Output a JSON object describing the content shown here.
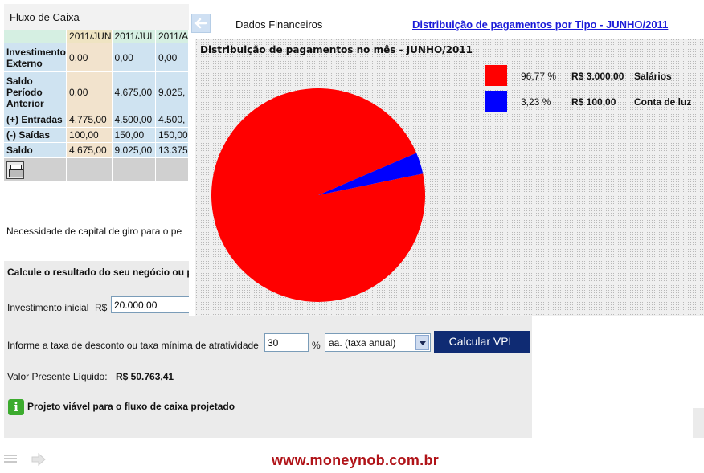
{
  "fluxo": {
    "title": "Fluxo de Caixa",
    "columns": [
      "2011/JUN",
      "2011/JUL",
      "2011/A"
    ],
    "rows": [
      {
        "label": "Investimento Externo",
        "values": [
          "0,00",
          "0,00",
          "0,00"
        ]
      },
      {
        "label": "Saldo Período Anterior",
        "values": [
          "0,00",
          "4.675,00",
          "9.025,"
        ]
      },
      {
        "label": "(+) Entradas",
        "values": [
          "4.775,00",
          "4.500,00",
          "4.500,"
        ]
      },
      {
        "label": "(-) Saídas",
        "values": [
          "100,00",
          "150,00",
          "150,00"
        ]
      },
      {
        "label": "Saldo",
        "values": [
          "4.675,00",
          "9.025,00",
          "13.375"
        ]
      }
    ],
    "print_icon": "printer-icon"
  },
  "capital": {
    "text": "Necessidade de capital de giro para o pe"
  },
  "calc": {
    "title": "Calcule o resultado do seu negócio ou p",
    "investment_label": "Investimento inicial",
    "currency": "R$",
    "investment_value": "20.000,00",
    "rate_label": "Informe a taxa de desconto ou taxa mínima de atratividade",
    "rate_value": "30",
    "percent_sign": "%",
    "period_selected": "aa. (taxa anual)",
    "calculate_button": "Calcular VPL",
    "vpl_label": "Valor Presente Líquido:",
    "vpl_value": "R$ 50.763,41",
    "viable_icon_glyph": "i",
    "viable_text": "Projeto viável para o fluxo de caixa projetado"
  },
  "footer": {
    "url": "www.moneynob.com.br"
  },
  "chart_window": {
    "back_icon": "back-arrow-icon",
    "nav_label": "Dados Financeiros",
    "link": "Distribuição de pagamentos por Tipo - JUNHO/2011"
  },
  "colors": {
    "salarios": "#ff0000",
    "conta_de_luz": "#0000ff",
    "vpl_button": "#0f2b73",
    "url_text": "#b01318"
  },
  "chart_data": {
    "type": "pie",
    "title": "Distribuição de pagamentos no mês - JUNHO/2011",
    "legend_position": "right",
    "slices": [
      {
        "name": "Salários",
        "percent": 96.77,
        "percent_label": "96,77 %",
        "value": 3000,
        "value_label": "R$ 3.000,00",
        "color": "#ff0000"
      },
      {
        "name": "Conta de luz",
        "percent": 3.23,
        "percent_label": "3,23 %",
        "value": 100,
        "value_label": "R$ 100,00",
        "color": "#0000ff"
      }
    ]
  }
}
